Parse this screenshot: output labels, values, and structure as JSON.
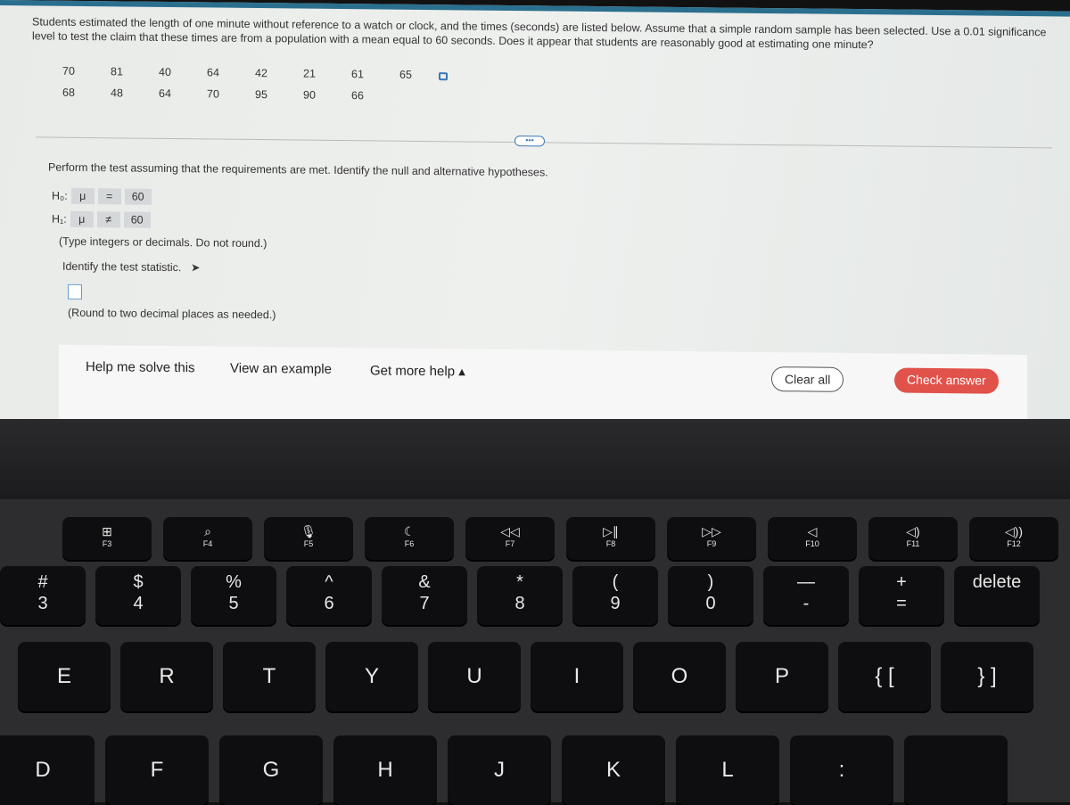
{
  "question": "Students estimated the length of one minute without reference to a watch or clock, and the times (seconds) are listed below. Assume that a simple random sample has been selected. Use a 0.01 significance level to test the claim that these times are from a population with a mean equal to 60 seconds. Does it appear that students are reasonably good at estimating one minute?",
  "data_rows": [
    [
      "70",
      "81",
      "40",
      "64",
      "42",
      "21",
      "61",
      "65"
    ],
    [
      "68",
      "48",
      "64",
      "70",
      "95",
      "90",
      "66"
    ]
  ],
  "more_label": "•••",
  "instruction": "Perform the test assuming that the requirements are met. Identify the null and alternative hypotheses.",
  "h0": {
    "label": "H₀:",
    "param": "μ",
    "op": "=",
    "value": "60"
  },
  "h1": {
    "label": "H₁:",
    "param": "μ",
    "op": "≠",
    "value": "60"
  },
  "note_hyp": "(Type integers or decimals. Do not round.)",
  "test_stat_prompt": "Identify the test statistic.",
  "test_stat_value": "",
  "note_round": "(Round to two decimal places as needed.)",
  "actions": {
    "help": "Help me solve this",
    "example": "View an example",
    "more_help": "Get more help ▴",
    "clear": "Clear all",
    "check": "Check answer"
  },
  "colors": {
    "accent": "#3a78b5",
    "check": "#e0524a"
  },
  "keyboard": {
    "fn": [
      {
        "icon": "⊞",
        "label": "F3"
      },
      {
        "icon": "⌕",
        "label": "F4"
      },
      {
        "icon": "🎙",
        "label": "F5"
      },
      {
        "icon": "☾",
        "label": "F6"
      },
      {
        "icon": "◁◁",
        "label": "F7"
      },
      {
        "icon": "▷∥",
        "label": "F8"
      },
      {
        "icon": "▷▷",
        "label": "F9"
      },
      {
        "icon": "◁",
        "label": "F10"
      },
      {
        "icon": "◁)",
        "label": "F11"
      },
      {
        "icon": "◁))",
        "label": "F12"
      }
    ],
    "num": [
      {
        "t": "#",
        "b": "3"
      },
      {
        "t": "$",
        "b": "4"
      },
      {
        "t": "%",
        "b": "5"
      },
      {
        "t": "^",
        "b": "6"
      },
      {
        "t": "&",
        "b": "7"
      },
      {
        "t": "*",
        "b": "8"
      },
      {
        "t": "(",
        "b": "9"
      },
      {
        "t": ")",
        "b": "0"
      },
      {
        "t": "—",
        "b": "-"
      },
      {
        "t": "+",
        "b": "="
      },
      {
        "t": "",
        "b": "delete"
      }
    ],
    "top": [
      "E",
      "R",
      "T",
      "Y",
      "U",
      "I",
      "O",
      "P",
      "{ [",
      "} ]"
    ],
    "home": [
      "D",
      "F",
      "G",
      "H",
      "J",
      "K",
      "L",
      ":",
      ""
    ]
  }
}
